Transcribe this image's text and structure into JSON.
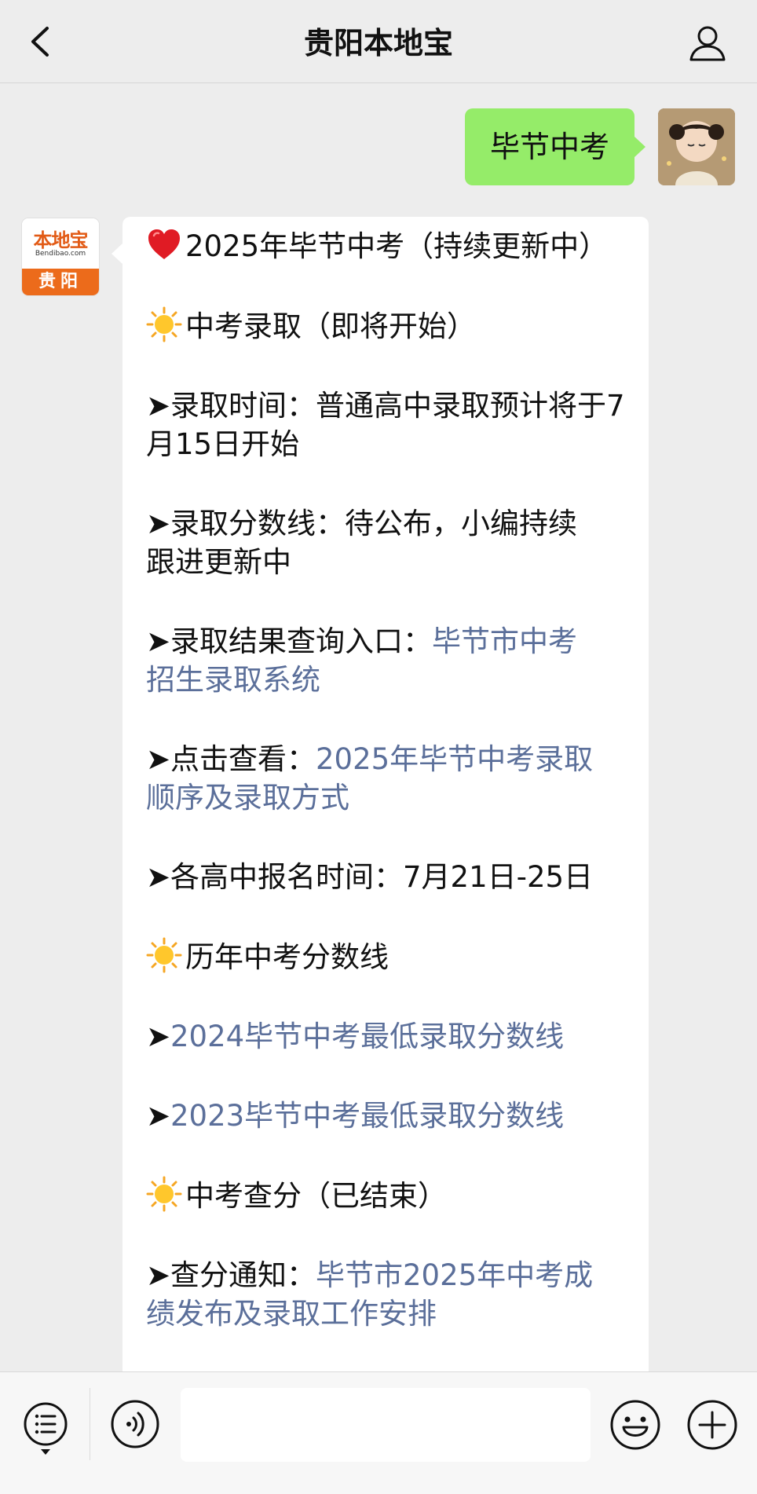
{
  "header": {
    "title": "贵阳本地宝",
    "back_icon": "chevron-left-icon",
    "profile_icon": "person-icon"
  },
  "chat": {
    "user_message": "毕节中考",
    "bot_avatar": {
      "logo_text": "本地宝",
      "logo_domain": "Bendibao.com",
      "city": "贵阳"
    },
    "message": {
      "title": "2025年毕节中考（持续更新中）",
      "section_admission": "中考录取（即将开始）",
      "admission_time": "➤录取时间：普通高中录取预计将于7月15日开始",
      "admission_score_line1": "➤录取分数线：待公布，小编持续",
      "admission_score_line2": "跟进更新中",
      "result_query_prefix": "➤录取结果查询入口：",
      "result_query_link_l1": "毕节市中考",
      "result_query_link_l2": "招生录取系统",
      "view_prefix": "➤点击查看：",
      "view_link_l1": "2025年毕节中考录取",
      "view_link_l2": "顺序及录取方式",
      "signup_time": "➤各高中报名时间：7月21日-25日",
      "section_history": "历年中考分数线",
      "arrow": "➤",
      "history_link_2024": "2024毕节中考最低录取分数线",
      "history_link_2023": "2023毕节中考最低录取分数线",
      "section_score": "中考查分（已结束）",
      "score_notice_prefix": "➤查分通知：",
      "score_notice_link_l1": "毕节市2025年中考成",
      "score_notice_link_l2": "绩发布及录取工作安排"
    }
  },
  "bottombar": {
    "menu_icon": "list-menu-icon",
    "voice_icon": "voice-icon",
    "input_value": "",
    "emoji_icon": "smiley-icon",
    "plus_icon": "plus-icon"
  },
  "colors": {
    "background": "#ededed",
    "my_bubble": "#95ec69",
    "link": "#5b6f9a",
    "brand_orange": "#ec6b1b"
  }
}
